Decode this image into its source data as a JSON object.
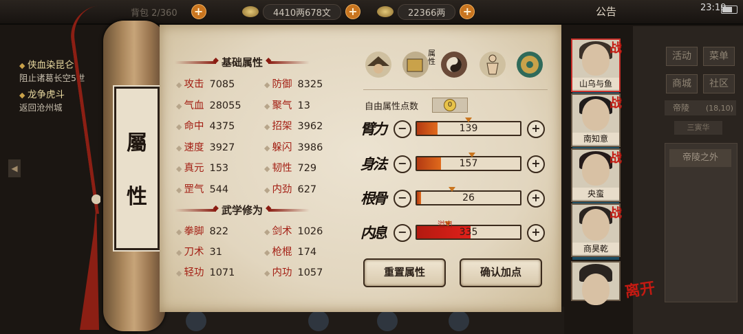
{
  "topbar": {
    "stamina": "背包 2/360",
    "money": "4410两678文",
    "silver": "22366两",
    "notice": "公告",
    "time": "23:19"
  },
  "quests": [
    {
      "title": "侠血染昆仑",
      "desc": "阻止诸葛长空5世"
    },
    {
      "title": "龙争虎斗",
      "desc": "返回沧州城"
    }
  ],
  "scroll": {
    "char1": "屬",
    "char2": "性"
  },
  "base_header": "基础属性",
  "base_stats_left": [
    {
      "label": "攻击",
      "value": "7085"
    },
    {
      "label": "气血",
      "value": "28055"
    },
    {
      "label": "命中",
      "value": "4375"
    },
    {
      "label": "速度",
      "value": "3927"
    },
    {
      "label": "真元",
      "value": "153"
    },
    {
      "label": "罡气",
      "value": "544"
    }
  ],
  "base_stats_right": [
    {
      "label": "防御",
      "value": "8325"
    },
    {
      "label": "聚气",
      "value": "13"
    },
    {
      "label": "招架",
      "value": "3962"
    },
    {
      "label": "躲闪",
      "value": "3986"
    },
    {
      "label": "韧性",
      "value": "729"
    },
    {
      "label": "内劲",
      "value": "627"
    }
  ],
  "martial_header": "武学修为",
  "martial_left": [
    {
      "label": "拳脚",
      "value": "822"
    },
    {
      "label": "刀术",
      "value": "31"
    },
    {
      "label": "轻功",
      "value": "1071"
    }
  ],
  "martial_right": [
    {
      "label": "剑术",
      "value": "1026"
    },
    {
      "label": "枪棍",
      "value": "174"
    },
    {
      "label": "内功",
      "value": "1057"
    }
  ],
  "tabs": [
    "character-hat-icon",
    "attribute-scroll-icon",
    "taiji-icon",
    "meridian-body-icon",
    "compass-icon"
  ],
  "tab_active_label": "属性",
  "free_points_label": "自由属性点数",
  "free_points_value": "0",
  "attributes": [
    {
      "name": "臂力",
      "value": "139",
      "fill": 0.2
    },
    {
      "name": "身法",
      "value": "157",
      "fill": 0.23
    },
    {
      "name": "根骨",
      "value": "26",
      "fill": 0.04
    },
    {
      "name": "内息",
      "value": "335",
      "fill": 0.52
    }
  ],
  "overflow_label": "溢出",
  "buttons": {
    "reset": "重置属性",
    "confirm": "确认加点"
  },
  "party": [
    {
      "name": "山乌与鱼",
      "tag": "战"
    },
    {
      "name": "南知意",
      "tag": "战"
    },
    {
      "name": "央蛮",
      "tag": "战"
    },
    {
      "name": "商昊乾",
      "tag": "战"
    }
  ],
  "leave_label": "离开",
  "right_menu": {
    "b1": "活动",
    "b2": "菜单",
    "b3": "商城",
    "b4": "社区",
    "location": "帝陵",
    "coords": "(18,10)",
    "sub": "三寅华",
    "area": "帝陵之外"
  },
  "colors": {
    "accent_red": "#a31f14",
    "bar_fill": "#e06a1c",
    "paper": "#e6dcc7"
  }
}
